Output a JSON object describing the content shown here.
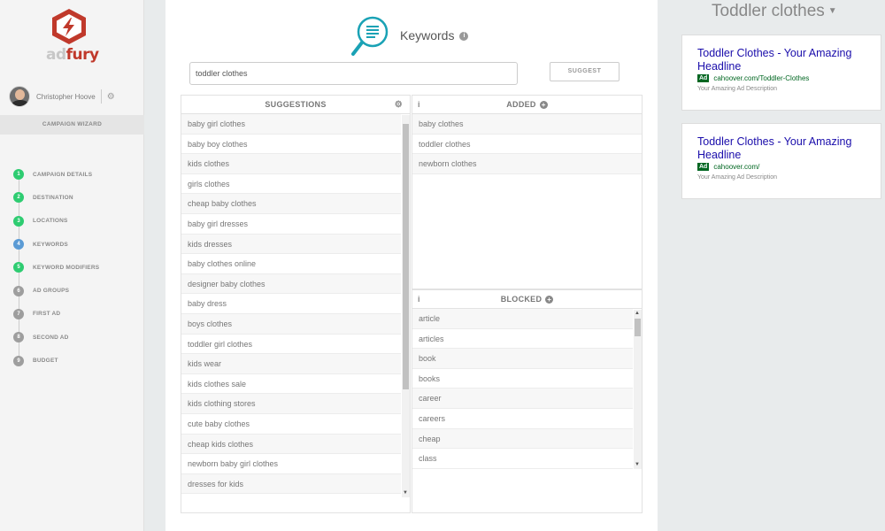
{
  "brand": {
    "ad": "ad",
    "fury": "fury",
    "color": "#c0392b"
  },
  "user": {
    "name": "Christopher Hoove",
    "settings_icon": "gear-icon"
  },
  "wizard": {
    "label": "CAMPAIGN WIZARD",
    "steps": [
      {
        "num": "1",
        "label": "CAMPAIGN DETAILS",
        "color": "#2ecc71"
      },
      {
        "num": "2",
        "label": "DESTINATION",
        "color": "#2ecc71"
      },
      {
        "num": "3",
        "label": "LOCATIONS",
        "color": "#2ecc71"
      },
      {
        "num": "4",
        "label": "KEYWORDS",
        "color": "#5b9bd5"
      },
      {
        "num": "5",
        "label": "KEYWORD MODIFIERS",
        "color": "#2ecc71"
      },
      {
        "num": "6",
        "label": "AD GROUPS",
        "color": "#9e9e9e"
      },
      {
        "num": "7",
        "label": "FIRST AD",
        "color": "#9e9e9e"
      },
      {
        "num": "8",
        "label": "SECOND AD",
        "color": "#9e9e9e"
      },
      {
        "num": "9",
        "label": "BUDGET",
        "color": "#9e9e9e"
      }
    ]
  },
  "keywords": {
    "title": "Keywords",
    "info": "i",
    "search_value": "toddler clothes",
    "suggest_label": "SUGGEST",
    "accent": "#1aa2b5"
  },
  "suggestions": {
    "header": "SUGGESTIONS",
    "items": [
      "baby girl clothes",
      "baby boy clothes",
      "kids clothes",
      "girls clothes",
      "cheap baby clothes",
      "baby girl dresses",
      "kids dresses",
      "baby clothes online",
      "designer baby clothes",
      "baby dress",
      "boys clothes",
      "toddler girl clothes",
      "kids wear",
      "kids clothes sale",
      "kids clothing stores",
      "cute baby clothes",
      "cheap kids clothes",
      "newborn baby girl clothes",
      "dresses for kids"
    ]
  },
  "added": {
    "header": "ADDED",
    "info": "i",
    "items": [
      "baby clothes",
      "toddler clothes",
      "newborn clothes"
    ]
  },
  "blocked": {
    "header": "BLOCKED",
    "info": "i",
    "items": [
      "article",
      "articles",
      "book",
      "books",
      "career",
      "careers",
      "cheap",
      "class"
    ]
  },
  "ads": {
    "title": "Toddler clothes",
    "cards": [
      {
        "headline": "Toddler Clothes - Your Amazing Headline",
        "badge": "Ad",
        "url": "cahoover.com/Toddler-Clothes",
        "desc": "Your Amazing Ad Description"
      },
      {
        "headline": "Toddler Clothes - Your Amazing Headline",
        "badge": "Ad",
        "url": "cahoover.com/",
        "desc": "Your Amazing Ad Description"
      }
    ]
  }
}
